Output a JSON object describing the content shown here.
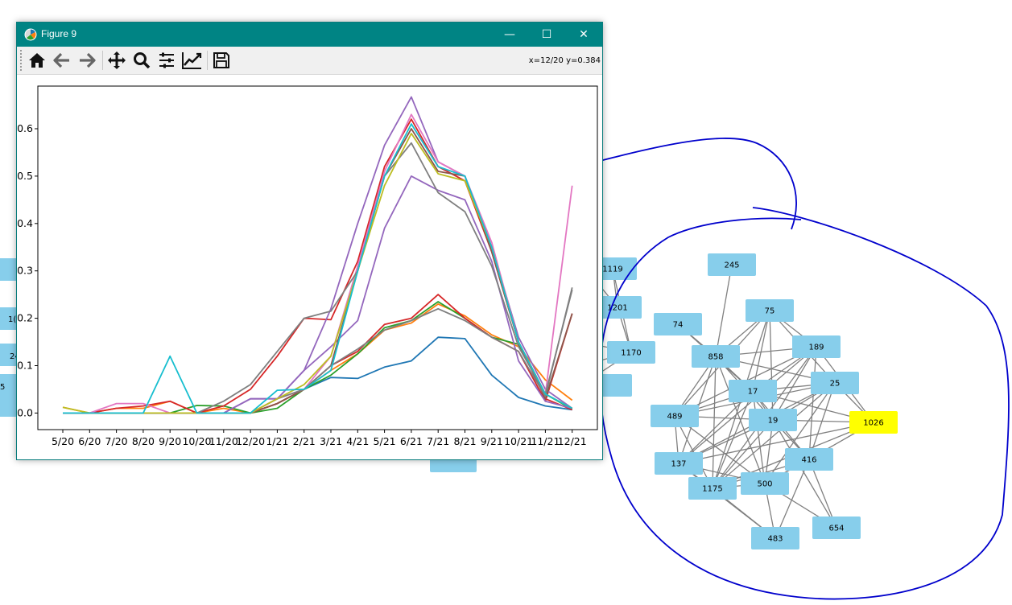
{
  "window": {
    "title": "Figure 9",
    "min_glyph": "—",
    "max_glyph": "☐",
    "close_glyph": "✕"
  },
  "toolbar": {
    "buttons": [
      "home",
      "back",
      "forward",
      "pan",
      "zoom",
      "configure-subplots",
      "edit-axis",
      "save"
    ],
    "coord_readout": "x=12/20 y=0.384"
  },
  "graph": {
    "nodes": [
      {
        "id": "245",
        "highlight": false
      },
      {
        "id": "75",
        "highlight": false
      },
      {
        "id": "74",
        "highlight": false
      },
      {
        "id": "858",
        "highlight": false
      },
      {
        "id": "189",
        "highlight": false
      },
      {
        "id": "25",
        "highlight": false
      },
      {
        "id": "17",
        "highlight": false
      },
      {
        "id": "489",
        "highlight": false
      },
      {
        "id": "19",
        "highlight": false
      },
      {
        "id": "1026",
        "highlight": true
      },
      {
        "id": "137",
        "highlight": false
      },
      {
        "id": "416",
        "highlight": false
      },
      {
        "id": "1175",
        "highlight": false
      },
      {
        "id": "500",
        "highlight": false
      },
      {
        "id": "654",
        "highlight": false
      },
      {
        "id": "483",
        "highlight": false
      },
      {
        "id": "1119",
        "highlight": false
      },
      {
        "id": "1201",
        "highlight": false
      },
      {
        "id": "1170",
        "highlight": false
      }
    ],
    "partial_node_labels": [
      "1(",
      "24",
      "5"
    ],
    "node_color": "#87ceeb",
    "highlight_color": "#ffff00",
    "edge_color": "#808080",
    "annotation_color": "#0000cc"
  },
  "chart_data": {
    "type": "line",
    "categories": [
      "5/20",
      "6/20",
      "7/20",
      "8/20",
      "9/20",
      "10/20",
      "11/20",
      "12/20",
      "1/21",
      "2/21",
      "3/21",
      "4/21",
      "5/21",
      "6/21",
      "7/21",
      "8/21",
      "9/21",
      "10/21",
      "11/21",
      "12/21"
    ],
    "yticks": [
      0.0,
      0.1,
      0.2,
      0.3,
      0.4,
      0.5,
      0.6
    ],
    "ytick_labels": [
      "0.0",
      "0.1",
      "0.2",
      "0.3",
      "0.4",
      "0.5",
      "0.6"
    ],
    "ylim": [
      -0.035,
      0.69
    ],
    "grid": false,
    "series": [
      {
        "color": "#1f77b4",
        "values": [
          0.0,
          0.0,
          0.0,
          0.0,
          0.0,
          0.0,
          0.0,
          0.0,
          0.02,
          0.05,
          0.075,
          0.073,
          0.097,
          0.11,
          0.16,
          0.157,
          0.08,
          0.033,
          0.015,
          0.007
        ]
      },
      {
        "color": "#ff7f0e",
        "values": [
          0.012,
          0.0,
          0.01,
          0.01,
          0.025,
          0.0,
          0.01,
          0.0,
          0.02,
          0.05,
          0.09,
          0.125,
          0.175,
          0.19,
          0.23,
          0.205,
          0.165,
          0.14,
          0.07,
          0.027
        ]
      },
      {
        "color": "#2ca02c",
        "values": [
          0.0,
          0.0,
          0.0,
          0.0,
          0.0,
          0.016,
          0.015,
          0.0,
          0.01,
          0.05,
          0.08,
          0.125,
          0.18,
          0.195,
          0.235,
          0.2,
          0.16,
          0.145,
          0.04,
          0.008
        ]
      },
      {
        "color": "#d62728",
        "values": [
          0.0,
          0.0,
          0.01,
          0.015,
          0.025,
          0.0,
          0.015,
          0.05,
          0.12,
          0.2,
          0.197,
          0.32,
          0.52,
          0.62,
          0.52,
          0.49,
          0.34,
          0.15,
          0.03,
          0.007
        ]
      },
      {
        "color": "#d62728",
        "values": [
          0.0,
          0.0,
          0.0,
          0.0,
          0.0,
          0.0,
          0.0,
          0.0,
          0.02,
          0.05,
          0.1,
          0.13,
          0.187,
          0.2,
          0.25,
          0.2,
          0.16,
          0.13,
          0.025,
          0.21
        ]
      },
      {
        "color": "#9467bd",
        "values": [
          0.0,
          0.0,
          0.0,
          0.0,
          0.0,
          0.0,
          0.0,
          0.03,
          0.03,
          0.09,
          0.14,
          0.195,
          0.39,
          0.5,
          0.47,
          0.45,
          0.32,
          0.11,
          0.025,
          0.01
        ]
      },
      {
        "color": "#9467bd",
        "values": [
          0.0,
          0.0,
          0.0,
          0.0,
          0.0,
          0.0,
          0.0,
          0.03,
          0.03,
          0.09,
          0.22,
          0.4,
          0.565,
          0.667,
          0.53,
          0.5,
          0.35,
          0.16,
          0.05,
          0.01
        ]
      },
      {
        "color": "#8c564b",
        "values": [
          0.0,
          0.0,
          0.0,
          0.0,
          0.0,
          0.0,
          0.0,
          0.0,
          0.02,
          0.05,
          0.1,
          0.3,
          0.5,
          0.6,
          0.51,
          0.5,
          0.34,
          0.15,
          0.03,
          0.21
        ]
      },
      {
        "color": "#e377c2",
        "values": [
          0.0,
          0.0,
          0.02,
          0.02,
          0.0,
          0.0,
          0.0,
          0.0,
          0.03,
          0.05,
          0.12,
          0.31,
          0.51,
          0.63,
          0.53,
          0.5,
          0.36,
          0.15,
          0.04,
          0.48
        ]
      },
      {
        "color": "#7f7f7f",
        "values": [
          0.0,
          0.0,
          0.0,
          0.0,
          0.0,
          0.0,
          0.025,
          0.06,
          0.13,
          0.2,
          0.215,
          0.3,
          0.5,
          0.57,
          0.465,
          0.425,
          0.31,
          0.14,
          0.04,
          0.26
        ]
      },
      {
        "color": "#7f7f7f",
        "values": [
          0.0,
          0.0,
          0.0,
          0.0,
          0.0,
          0.0,
          0.0,
          0.0,
          0.03,
          0.05,
          0.1,
          0.135,
          0.175,
          0.195,
          0.22,
          0.195,
          0.16,
          0.13,
          0.035,
          0.265
        ]
      },
      {
        "color": "#bcbd22",
        "values": [
          0.012,
          0.0,
          0.0,
          0.0,
          0.0,
          0.0,
          0.0,
          0.0,
          0.03,
          0.06,
          0.12,
          0.3,
          0.48,
          0.59,
          0.505,
          0.49,
          0.35,
          0.15,
          0.04,
          0.01
        ]
      },
      {
        "color": "#17becf",
        "values": [
          0.0,
          0.0,
          0.0,
          0.0,
          0.12,
          0.0,
          0.0,
          0.0,
          0.048,
          0.05,
          0.09,
          0.3,
          0.5,
          0.61,
          0.52,
          0.5,
          0.35,
          0.15,
          0.04,
          0.01
        ]
      }
    ]
  }
}
